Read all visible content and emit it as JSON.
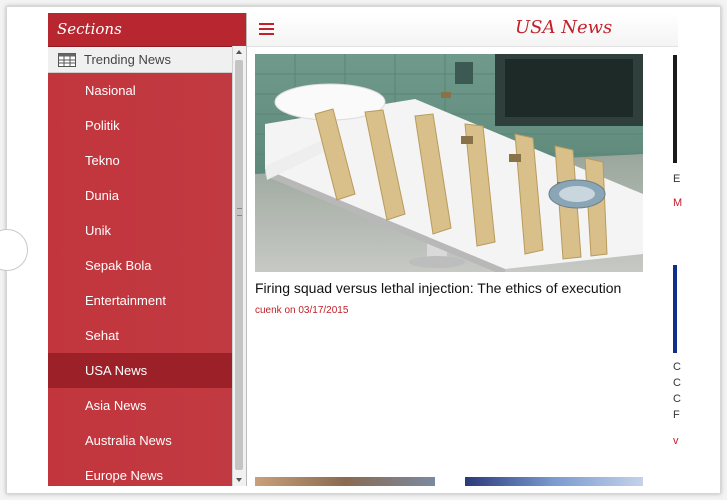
{
  "sidebar": {
    "header": "Sections",
    "trending_label": "Trending News",
    "items": [
      {
        "label": "Nasional"
      },
      {
        "label": "Politik"
      },
      {
        "label": "Tekno"
      },
      {
        "label": "Dunia"
      },
      {
        "label": "Unik"
      },
      {
        "label": "Sepak Bola"
      },
      {
        "label": "Entertainment"
      },
      {
        "label": "Sehat"
      },
      {
        "label": "USA News",
        "active": true
      },
      {
        "label": "Asia News"
      },
      {
        "label": "Australia News"
      },
      {
        "label": "Europe News"
      }
    ]
  },
  "header": {
    "title": "USA News"
  },
  "main": {
    "article": {
      "title": "Firing squad versus lethal injection: The ethics of execution",
      "meta": "cuenk on 03/17/2015"
    },
    "right_column_fragments": [
      "E",
      "M",
      "C",
      "C",
      "C",
      "F",
      "v"
    ]
  },
  "colors": {
    "sidebar_bg": "#c2353d",
    "sidebar_active": "#9c2028",
    "accent": "#c2202a"
  },
  "icons": {
    "menu": "hamburger-icon",
    "trending": "grid-icon"
  }
}
